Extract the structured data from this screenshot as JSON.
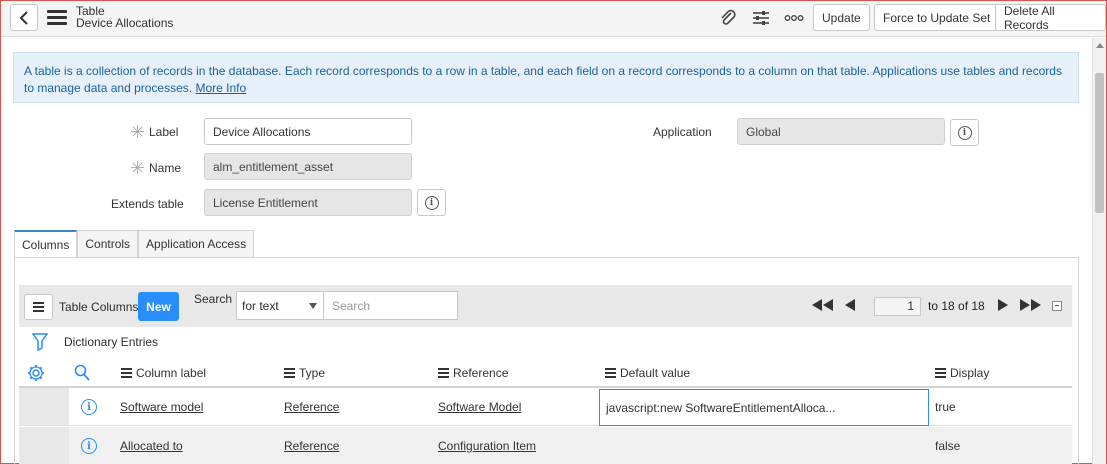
{
  "header": {
    "title": "Table",
    "subtitle": "Device Allocations",
    "buttons": {
      "update": "Update",
      "force_update": "Force to Update Set",
      "delete_all": "Delete All Records"
    }
  },
  "info": {
    "text": "A table is a collection of records in the database. Each record corresponds to a row in a table, and each field on a record corresponds to a column on that table. Applications use tables and records to manage data and processes.",
    "more_link": "More Info"
  },
  "form": {
    "label_label": "Label",
    "label_value": "Device Allocations",
    "name_label": "Name",
    "name_value": "alm_entitlement_asset",
    "extends_label": "Extends table",
    "extends_value": "License Entitlement",
    "application_label": "Application",
    "application_value": "Global"
  },
  "tabs": [
    "Columns",
    "Controls",
    "Application Access"
  ],
  "list": {
    "title": "Table Columns",
    "new_label": "New",
    "search_label": "Search",
    "search_select": "for text",
    "search_placeholder": "Search",
    "pager_value": "1",
    "pager_total": "to 18 of 18",
    "breadcrumb": "Dictionary Entries",
    "columns": [
      "Column label",
      "Type",
      "Reference",
      "Default value",
      "Display"
    ],
    "rows": [
      {
        "label": "Software model",
        "type": "Reference",
        "reference": "Software Model",
        "default": "javascript:new SoftwareEntitlementAlloca...",
        "display": "true"
      },
      {
        "label": "Allocated to",
        "type": "Reference",
        "reference": "Configuration Item",
        "default": "",
        "display": "false"
      }
    ]
  },
  "colors": {
    "accent": "#278efc",
    "info_bg": "#e5f0fa",
    "info_text": "#1f5f96"
  }
}
